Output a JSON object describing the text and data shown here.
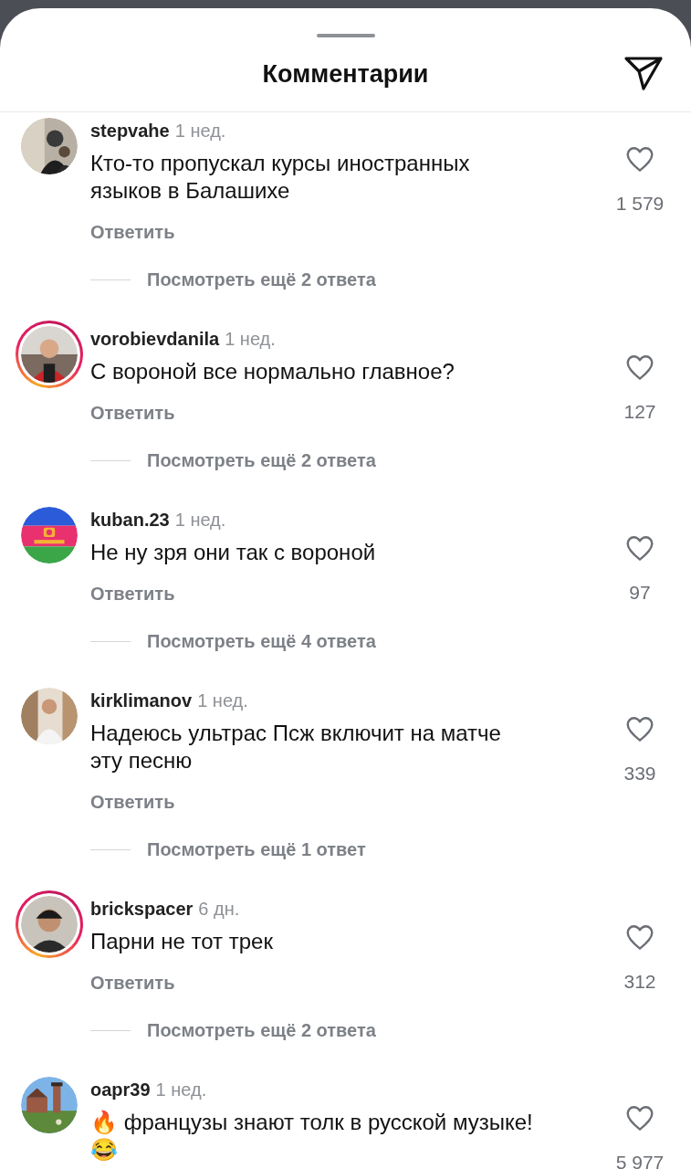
{
  "sheet": {
    "title": "Комментарии"
  },
  "comments": [
    {
      "avatar": {
        "kind": "picture",
        "story": false
      },
      "username": "stepvahe",
      "time": "1 нед.",
      "text": "Кто-то пропускал курсы иностранных языков в Балашихе",
      "reply": "Ответить",
      "likes": "1 579",
      "more_replies": "Посмотреть ещё 2 ответа"
    },
    {
      "avatar": {
        "kind": "picture",
        "story": true
      },
      "username": "vorobievdanila",
      "time": "1 нед.",
      "text": "С вороной все нормально главное?",
      "reply": "Ответить",
      "likes": "127",
      "more_replies": "Посмотреть ещё 2 ответа"
    },
    {
      "avatar": {
        "kind": "picture",
        "story": false
      },
      "username": "kuban.23",
      "time": "1 нед.",
      "text": "Не ну зря они так с вороной",
      "reply": "Ответить",
      "likes": "97",
      "more_replies": "Посмотреть ещё 4 ответа"
    },
    {
      "avatar": {
        "kind": "picture",
        "story": false
      },
      "username": "kirklimanov",
      "time": "1 нед.",
      "text": "Надеюсь ультрас Псж включит на матче эту песню",
      "reply": "Ответить",
      "likes": "339",
      "more_replies": "Посмотреть ещё 1 ответ"
    },
    {
      "avatar": {
        "kind": "picture",
        "story": true
      },
      "username": "brickspacer",
      "time": "6 дн.",
      "text": "Парни не тот трек",
      "reply": "Ответить",
      "likes": "312",
      "more_replies": "Посмотреть ещё 2 ответа"
    },
    {
      "avatar": {
        "kind": "picture",
        "story": false
      },
      "username": "oapr39",
      "time": "1 нед.",
      "text": "🔥 французы знают толк в русской музыке! 😂",
      "likes": "5 977"
    }
  ]
}
